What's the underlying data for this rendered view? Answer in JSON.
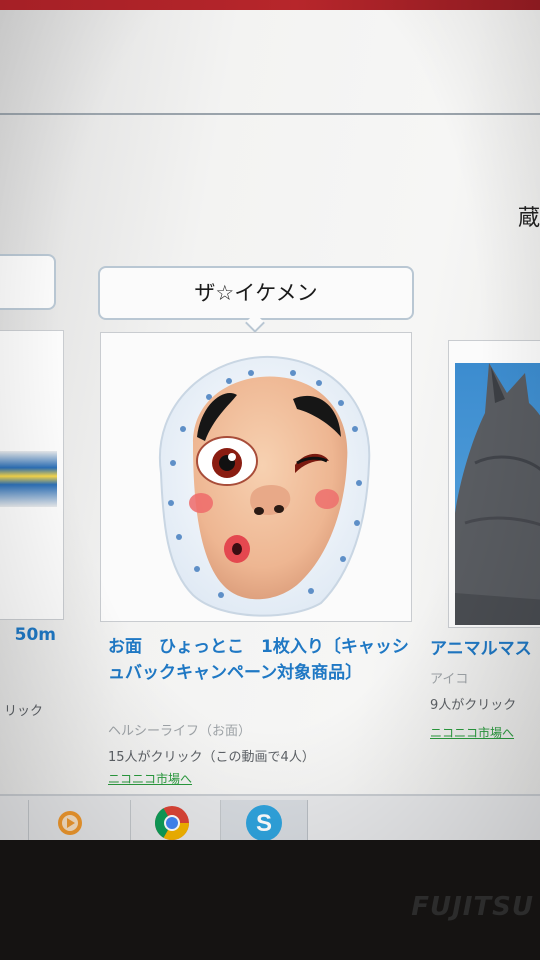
{
  "header": {
    "right_glyph": "蔵"
  },
  "products": {
    "left": {
      "title": "50m",
      "click_count": "リック"
    },
    "center": {
      "bubble_label": "ザ☆イケメン",
      "title": "お面　ひょっとこ　1枚入り〔キャッシュバックキャンペーン対象商品〕",
      "seller": "ヘルシーライフ（お面）",
      "click_count": "15人がクリック（この動画で4人）",
      "market_link": "ニコニコ市場へ"
    },
    "right": {
      "title": "アニマルマス",
      "seller": "アイコ",
      "click_count": "9人がクリック",
      "market_link": "ニコニコ市場へ"
    }
  },
  "taskbar": {
    "items": [
      {
        "icon": "media-player-icon"
      },
      {
        "icon": "chrome-icon"
      },
      {
        "icon": "skype-icon"
      }
    ]
  },
  "brand": "FUJITSU",
  "colors": {
    "link_blue": "#1f78c4",
    "market_green": "#2a9b3e",
    "bubble_border": "#b9c7d3"
  }
}
